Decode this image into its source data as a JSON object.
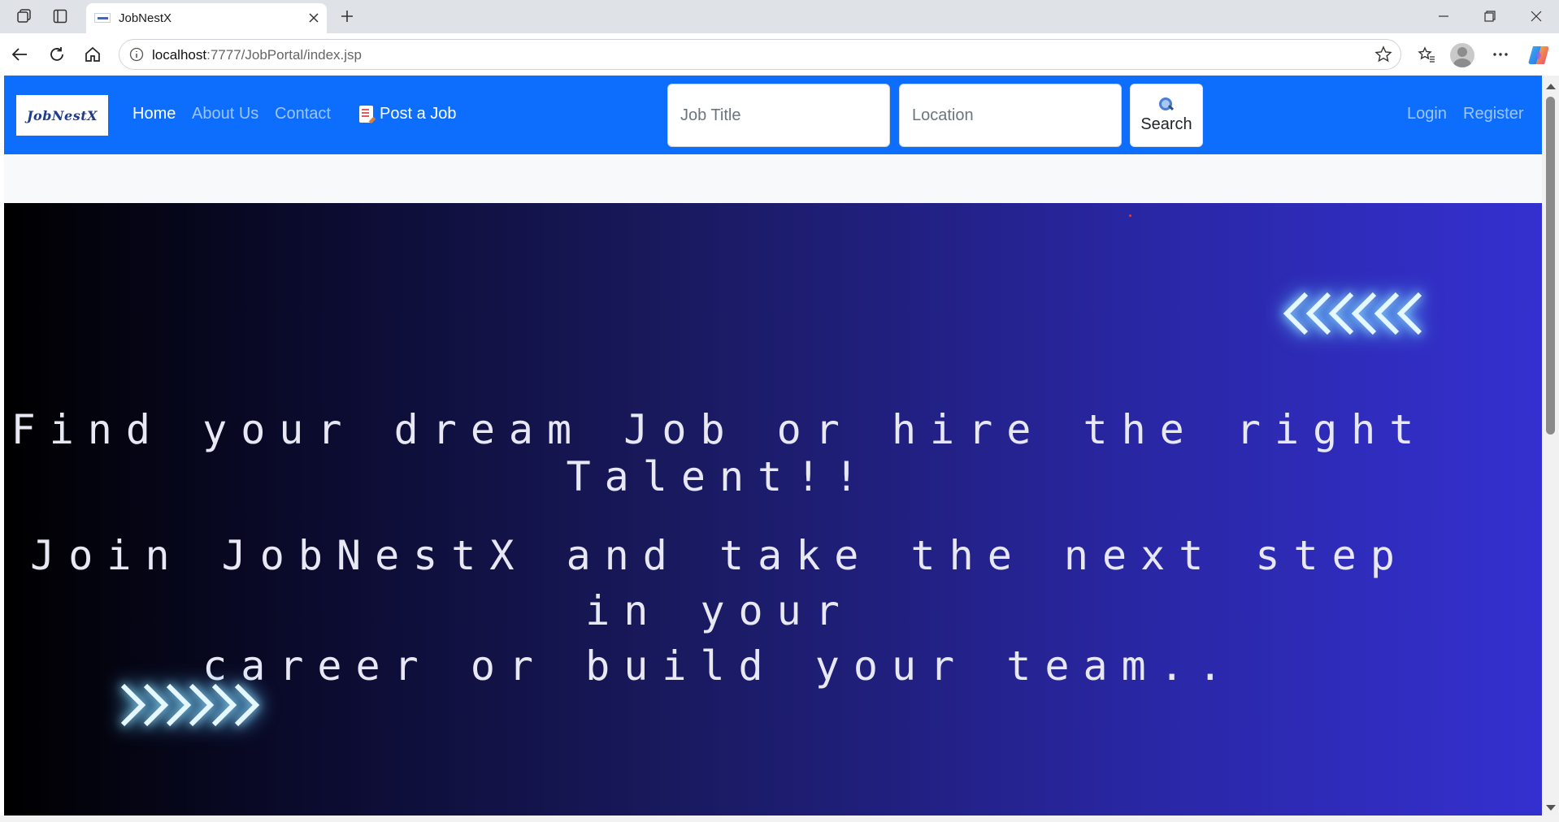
{
  "browser": {
    "tab_title": "JobNestX",
    "url_prefix": "localhost",
    "url_rest": ":7777/JobPortal/index.jsp"
  },
  "site": {
    "brand": "JobNestX",
    "nav": {
      "home": "Home",
      "about": "About Us",
      "contact": "Contact",
      "post_job": "Post a Job"
    },
    "search": {
      "job_title_placeholder": "Job Title",
      "location_placeholder": "Location",
      "button_label": "Search"
    },
    "auth": {
      "login": "Login",
      "register": "Register"
    },
    "colors": {
      "navbar": "#0d6efd",
      "hero_start": "#000000",
      "hero_end": "#3430d0",
      "glow": "#9fe4ff"
    }
  },
  "hero": {
    "line1": "Find your dream Job or hire the right Talent!!",
    "line2a": "Join JobNestX and take the next step in your",
    "line2b": "career or build your team.."
  }
}
